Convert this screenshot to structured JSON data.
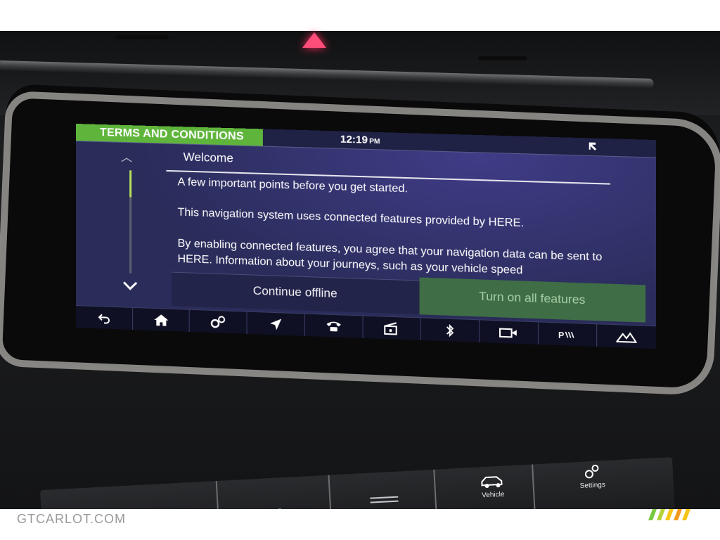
{
  "header": {
    "title": "TERMS AND CONDITIONS",
    "time": "12:19",
    "time_suffix": "PM",
    "close_icon": "pin-arrow-icon"
  },
  "content": {
    "heading": "Welcome",
    "paragraph_1": "A few important points before you get started.",
    "paragraph_2": "This navigation system uses connected features provided by HERE.",
    "paragraph_3": "By enabling connected features, you agree that your navigation data can be sent to HERE. Information about your journeys, such as your vehicle speed"
  },
  "buttons": {
    "continue_offline": "Continue offline",
    "turn_on_all": "Turn on all features"
  },
  "dock": [
    {
      "icon": "back-icon"
    },
    {
      "icon": "home-icon"
    },
    {
      "icon": "settings-gears-icon"
    },
    {
      "icon": "navigation-icon"
    },
    {
      "icon": "phone-icon"
    },
    {
      "icon": "media-icon"
    },
    {
      "icon": "bluetooth-icon"
    },
    {
      "icon": "camera-icon"
    },
    {
      "icon": "parking-icon"
    },
    {
      "icon": "terrain-icon"
    }
  ],
  "console": {
    "vehicle_label": "Vehicle",
    "settings_label": "Settings"
  },
  "watermark": "GTCARLOT.COM",
  "colors": {
    "title_bar": "#5fb53c",
    "primary_button": "#3f6d46",
    "screen_bg": "#2a2c5a"
  }
}
